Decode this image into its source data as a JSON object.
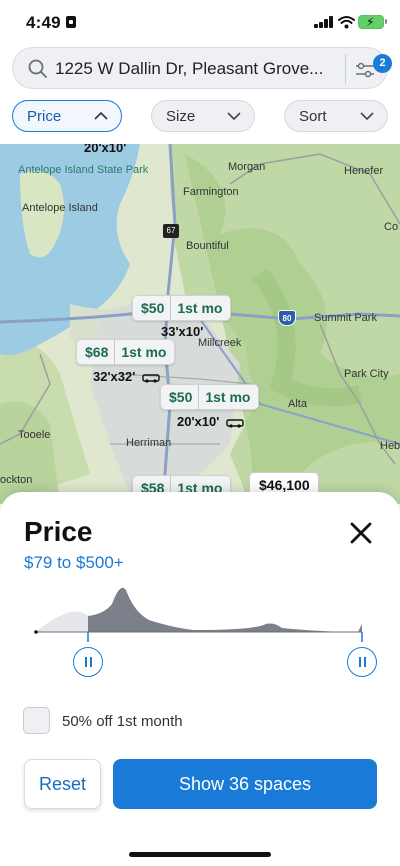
{
  "status": {
    "time": "4:49"
  },
  "search": {
    "text": "1225 W Dallin Dr, Pleasant Grove...",
    "filter_count": "2"
  },
  "chips": [
    {
      "label": "Price"
    },
    {
      "label": "Size"
    },
    {
      "label": "Sort"
    }
  ],
  "map": {
    "places": {
      "layton": "20'x10'",
      "antelope_island_sp": "Antelope Island State Park",
      "antelope_island": "Antelope Island",
      "morgan": "Morgan",
      "henefer": "Henefer",
      "farmington": "Farmington",
      "bountiful": "Bountiful",
      "millcreek": "Millcreek",
      "summit_park": "Summit Park",
      "park_city": "Park City",
      "alta": "Alta",
      "tooele": "Tooele",
      "herriman": "Herriman",
      "heber": "Heb",
      "stockton": "ockton",
      "co": "Co"
    },
    "shields": {
      "sr67": "67",
      "i80": "80"
    },
    "markers": [
      {
        "price": "$50",
        "promo": "1st mo"
      },
      {
        "price": "$68",
        "promo": "1st mo"
      },
      {
        "price": "$50",
        "promo": "1st mo"
      },
      {
        "price": "$58",
        "promo": "1st mo"
      }
    ],
    "sizes": [
      "33'x10'",
      "32'x32'",
      "20'x10'"
    ],
    "big_price": "$46,100"
  },
  "sheet": {
    "title": "Price",
    "range": "$79 to $500+",
    "checkbox_label": "50% off 1st month",
    "reset_label": "Reset",
    "show_label": "Show 36 spaces"
  },
  "colors": {
    "accent": "#1a7ad8",
    "marker_text": "#1d6b52"
  }
}
